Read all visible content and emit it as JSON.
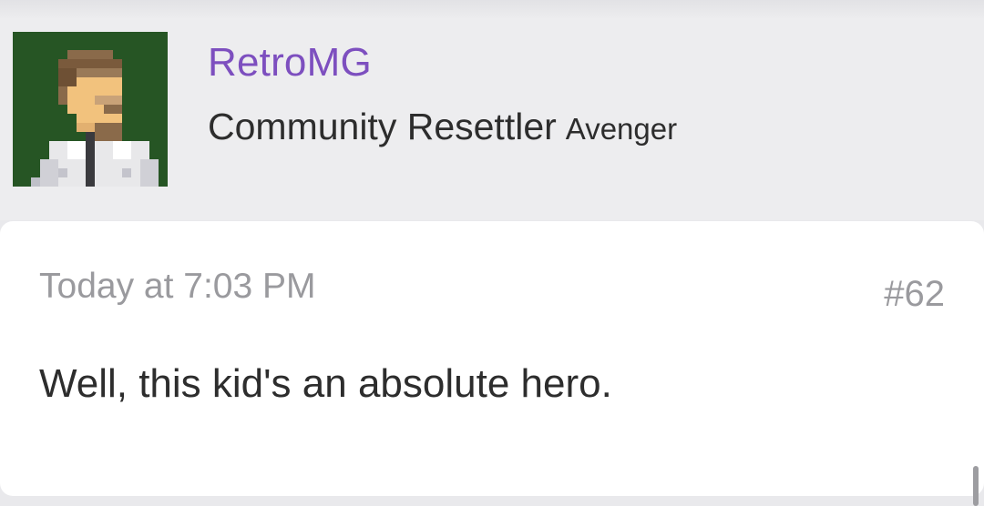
{
  "author": {
    "username": "RetroMG",
    "user_title": "Community Resettler",
    "rank": "Avenger",
    "avatar_icon": "pixel-art-portrait-icon",
    "username_color": "#7d4fbf"
  },
  "post": {
    "timestamp": "Today at 7:03 PM",
    "number": "#62",
    "body": "Well, this kid's an absolute hero."
  }
}
